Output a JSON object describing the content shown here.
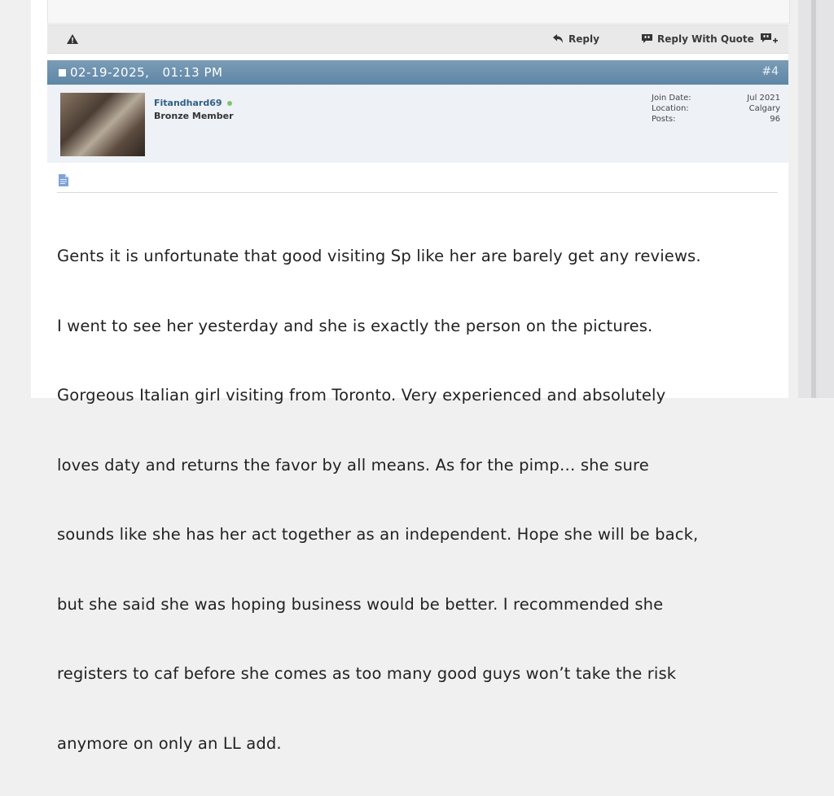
{
  "action_bar": {
    "reply_label": "Reply",
    "reply_with_quote_label": "Reply With Quote"
  },
  "post": {
    "date": "02-19-2025,",
    "time": "01:13 PM",
    "number": "#4",
    "user": {
      "name": "Fitandhard69",
      "title": "Bronze Member",
      "online": true
    },
    "stats": [
      {
        "label": "Join Date:",
        "value": "Jul 2021"
      },
      {
        "label": "Location:",
        "value": "Calgary"
      },
      {
        "label": "Posts:",
        "value": "96"
      }
    ],
    "message_lines": [
      "Gents it is unfortunate that good visiting Sp like her are barely get any reviews.",
      "I went to see her yesterday and she is exactly the person on the pictures.",
      "Gorgeous Italian girl visiting from Toronto. Very experienced and absolutely",
      "loves daty and returns the favor by all means. As for the pimp… she sure",
      "sounds like she has her act together as an independent. Hope she will be back,",
      "but she said she was hoping business would be better. I recommended she",
      "registers to caf before she comes as too many good guys won’t take the risk",
      "anymore on only an LL add."
    ]
  },
  "colors": {
    "header_bg": "#6a8fad",
    "username": "#2f5f86",
    "online": "#7fc46f"
  }
}
